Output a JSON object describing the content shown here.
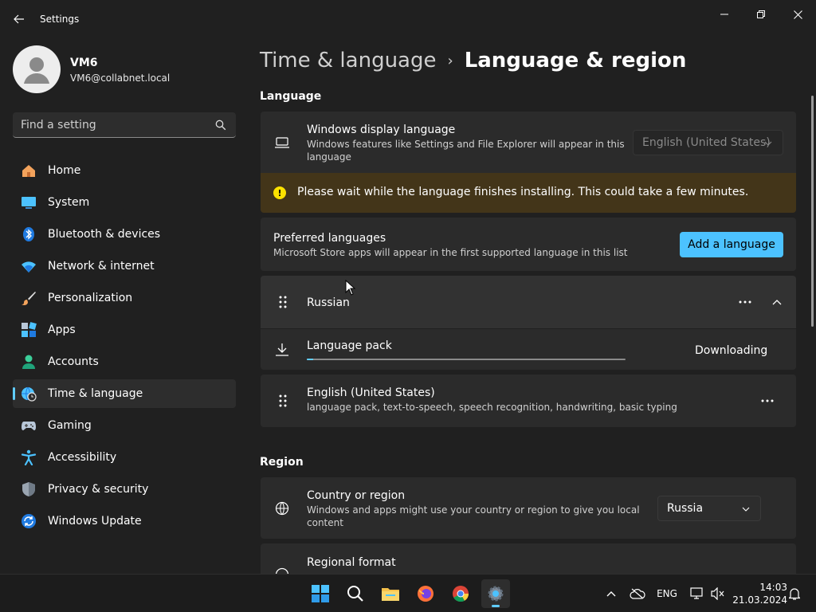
{
  "app": {
    "title": "Settings"
  },
  "user": {
    "name": "VM6",
    "email": "VM6@collabnet.local"
  },
  "search": {
    "placeholder": "Find a setting"
  },
  "nav": [
    {
      "label": "Home",
      "icon": "home-icon",
      "active": false
    },
    {
      "label": "System",
      "icon": "system-icon",
      "active": false
    },
    {
      "label": "Bluetooth & devices",
      "icon": "bluetooth-icon",
      "active": false
    },
    {
      "label": "Network & internet",
      "icon": "wifi-icon",
      "active": false
    },
    {
      "label": "Personalization",
      "icon": "brush-icon",
      "active": false
    },
    {
      "label": "Apps",
      "icon": "apps-icon",
      "active": false
    },
    {
      "label": "Accounts",
      "icon": "accounts-icon",
      "active": false
    },
    {
      "label": "Time & language",
      "icon": "globe-clock-icon",
      "active": true
    },
    {
      "label": "Gaming",
      "icon": "gamepad-icon",
      "active": false
    },
    {
      "label": "Accessibility",
      "icon": "accessibility-icon",
      "active": false
    },
    {
      "label": "Privacy & security",
      "icon": "shield-icon",
      "active": false
    },
    {
      "label": "Windows Update",
      "icon": "update-icon",
      "active": false
    }
  ],
  "breadcrumb": {
    "parent": "Time & language",
    "separator": "›",
    "current": "Language & region"
  },
  "language_section": {
    "title": "Language",
    "display_language": {
      "title": "Windows display language",
      "desc_line1": "Windows features like Settings and File Explorer will appear in this",
      "desc_line2": "language",
      "value": "English (United States)"
    },
    "warning": "Please wait while the language finishes installing. This could take a few minutes.",
    "preferred": {
      "title": "Preferred languages",
      "desc": "Microsoft Store apps will appear in the first supported language in this list",
      "add_button": "Add a language"
    },
    "russian": {
      "name": "Russian"
    },
    "language_pack": {
      "title": "Language pack",
      "status": "Downloading",
      "progress": 0.02
    },
    "english": {
      "name": "English (United States)",
      "desc": "language pack, text-to-speech, speech recognition, handwriting, basic typing"
    }
  },
  "region_section": {
    "title": "Region",
    "country": {
      "title": "Country or region",
      "desc_line1": "Windows and apps might use your country or region to give you local",
      "desc_line2": "content",
      "value": "Russia"
    },
    "format": {
      "title": "Regional format"
    }
  },
  "taskbar": {
    "language": "ENG",
    "time": "14:03",
    "date": "21.03.2024"
  },
  "colors": {
    "accent": "#4cc2ff",
    "warning_bg": "#433519",
    "warning_icon": "#fce100"
  }
}
